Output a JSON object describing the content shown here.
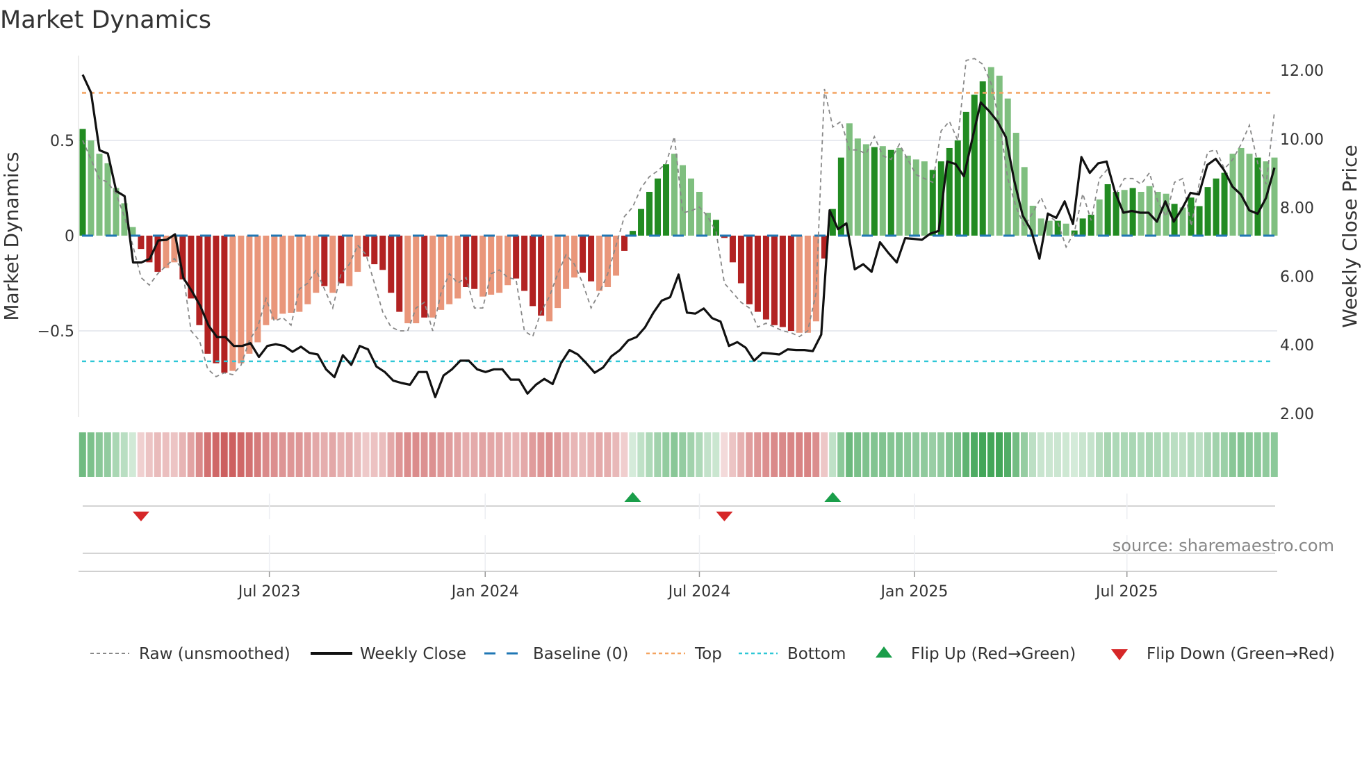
{
  "title": "Market Dynamics",
  "source_note": "source: sharemaestro.com",
  "colors": {
    "pos_strong": "#228B22",
    "pos_weak": "#7fbf7f",
    "neg_strong": "#b22222",
    "neg_weak": "#e9967a",
    "close": "#111111",
    "raw": "#888888",
    "baseline": "#1f77b4",
    "top": "#f4a460",
    "bottom": "#2ec7d6",
    "flip_up": "#1a9e4a",
    "flip_down": "#d62728"
  },
  "chart_data": {
    "type": "bar+line",
    "title": "Market Dynamics",
    "ylabel": "Market Dynamics",
    "y2label": "Weekly Close Price",
    "ylim": [
      -0.98,
      0.87
    ],
    "y2lim": [
      2.0,
      12.0
    ],
    "yticks": [
      {
        "value": 0.5,
        "label": "0.5"
      },
      {
        "value": 0,
        "label": "0"
      },
      {
        "value": -0.5,
        "label": "−0.5"
      }
    ],
    "y2ticks": [
      {
        "value": 12,
        "label": "12.00"
      },
      {
        "value": 10,
        "label": "10.00"
      },
      {
        "value": 8,
        "label": "8.00"
      },
      {
        "value": 6,
        "label": "6.00"
      },
      {
        "value": 4,
        "label": "4.00"
      },
      {
        "value": 2,
        "label": "2.00"
      }
    ],
    "xticks": [
      {
        "week": 22.4,
        "label": "Jul 2023"
      },
      {
        "week": 48.3,
        "label": "Jan 2024"
      },
      {
        "week": 74.0,
        "label": "Jul 2024"
      },
      {
        "week": 99.8,
        "label": "Jan 2025"
      },
      {
        "week": 125.3,
        "label": "Jul 2025"
      }
    ],
    "top_level": 0.75,
    "bottom_level": -0.66,
    "baseline": 0,
    "dynamics": [
      0.56,
      0.5,
      0.43,
      0.38,
      0.25,
      0.17,
      0.045,
      -0.07,
      -0.14,
      -0.19,
      -0.17,
      -0.14,
      -0.23,
      -0.33,
      -0.47,
      -0.62,
      -0.67,
      -0.72,
      -0.71,
      -0.67,
      -0.62,
      -0.56,
      -0.47,
      -0.44,
      -0.41,
      -0.405,
      -0.4,
      -0.36,
      -0.3,
      -0.265,
      -0.3,
      -0.25,
      -0.265,
      -0.19,
      -0.11,
      -0.15,
      -0.18,
      -0.3,
      -0.4,
      -0.46,
      -0.46,
      -0.43,
      -0.43,
      -0.39,
      -0.36,
      -0.33,
      -0.27,
      -0.28,
      -0.32,
      -0.31,
      -0.3,
      -0.26,
      -0.225,
      -0.29,
      -0.37,
      -0.42,
      -0.45,
      -0.38,
      -0.28,
      -0.22,
      -0.195,
      -0.24,
      -0.29,
      -0.27,
      -0.21,
      -0.08,
      0.025,
      0.14,
      0.23,
      0.3,
      0.375,
      0.43,
      0.37,
      0.3,
      0.23,
      0.12,
      0.083,
      -0.012,
      -0.14,
      -0.25,
      -0.36,
      -0.4,
      -0.44,
      -0.47,
      -0.48,
      -0.5,
      -0.51,
      -0.51,
      -0.45,
      -0.12,
      0.14,
      0.41,
      0.59,
      0.51,
      0.48,
      0.465,
      0.47,
      0.45,
      0.46,
      0.42,
      0.4,
      0.39,
      0.345,
      0.39,
      0.46,
      0.5,
      0.65,
      0.74,
      0.81,
      0.885,
      0.84,
      0.72,
      0.54,
      0.36,
      0.157,
      0.09,
      0.078,
      0.078,
      0.063,
      0.027,
      0.09,
      0.11,
      0.19,
      0.27,
      0.23,
      0.24,
      0.25,
      0.23,
      0.26,
      0.23,
      0.22,
      0.167,
      0.148,
      0.2,
      0.155,
      0.255,
      0.3,
      0.33,
      0.43,
      0.46,
      0.43,
      0.41,
      0.39,
      0.41
    ],
    "strength": "DLLLLLLDDDLLDDDDDDLLLLLLLLLLLDLDLLDDDDDLLDLLLLDDLLLLDDDDLLLLDDLLLDDDDDDLLLLLDDDDDDDDDDLLLDDDLLLDLDLLLLDDDDDDDLLLLLLLLDLDDDLDDLDLLLLDLDDDDDLLLD",
    "raw": [
      0.5,
      0.4,
      0.3,
      0.28,
      0.22,
      0.1,
      -0.05,
      -0.22,
      -0.26,
      -0.2,
      -0.16,
      -0.12,
      -0.18,
      -0.5,
      -0.55,
      -0.7,
      -0.74,
      -0.72,
      -0.73,
      -0.68,
      -0.55,
      -0.48,
      -0.33,
      -0.45,
      -0.43,
      -0.47,
      -0.28,
      -0.25,
      -0.18,
      -0.28,
      -0.38,
      -0.2,
      -0.15,
      -0.05,
      -0.1,
      -0.25,
      -0.4,
      -0.48,
      -0.5,
      -0.5,
      -0.38,
      -0.35,
      -0.5,
      -0.3,
      -0.2,
      -0.25,
      -0.22,
      -0.38,
      -0.38,
      -0.2,
      -0.18,
      -0.22,
      -0.23,
      -0.5,
      -0.53,
      -0.4,
      -0.32,
      -0.2,
      -0.1,
      -0.15,
      -0.25,
      -0.38,
      -0.3,
      -0.2,
      -0.05,
      0.1,
      0.15,
      0.25,
      0.31,
      0.34,
      0.38,
      0.52,
      0.12,
      0.13,
      0.15,
      0.1,
      0.02,
      -0.25,
      -0.3,
      -0.35,
      -0.38,
      -0.48,
      -0.46,
      -0.48,
      -0.5,
      -0.51,
      -0.53,
      -0.5,
      -0.3,
      0.77,
      0.57,
      0.6,
      0.45,
      0.45,
      0.43,
      0.52,
      0.42,
      0.4,
      0.48,
      0.4,
      0.32,
      0.3,
      0.28,
      0.55,
      0.6,
      0.5,
      0.92,
      0.93,
      0.9,
      0.8,
      0.6,
      0.3,
      0.15,
      0.05,
      0.12,
      0.2,
      0.1,
      0.07,
      -0.06,
      0.02,
      0.22,
      0.08,
      0.3,
      0.35,
      0.22,
      0.3,
      0.3,
      0.27,
      0.33,
      0.18,
      0.1,
      0.28,
      0.3,
      0.05,
      0.28,
      0.44,
      0.45,
      0.35,
      0.4,
      0.48,
      0.58,
      0.38,
      0.27,
      0.65
    ],
    "weekly_close": [
      11.87,
      11.34,
      9.67,
      9.57,
      8.48,
      8.33,
      6.4,
      6.4,
      6.51,
      7.04,
      7.06,
      7.22,
      5.95,
      5.57,
      5.14,
      4.56,
      4.23,
      4.23,
      3.97,
      3.97,
      4.05,
      3.65,
      3.97,
      4.02,
      3.97,
      3.8,
      3.95,
      3.77,
      3.72,
      3.29,
      3.06,
      3.7,
      3.42,
      3.97,
      3.87,
      3.37,
      3.21,
      2.96,
      2.89,
      2.84,
      3.21,
      3.21,
      2.48,
      3.11,
      3.29,
      3.54,
      3.54,
      3.29,
      3.21,
      3.29,
      3.29,
      2.99,
      2.99,
      2.58,
      2.84,
      3.01,
      2.86,
      3.47,
      3.85,
      3.72,
      3.47,
      3.19,
      3.34,
      3.67,
      3.85,
      4.13,
      4.23,
      4.51,
      4.94,
      5.29,
      5.39,
      6.05,
      4.94,
      4.91,
      5.06,
      4.78,
      4.68,
      3.97,
      4.08,
      3.92,
      3.54,
      3.77,
      3.75,
      3.72,
      3.87,
      3.85,
      3.85,
      3.82,
      4.3,
      7.92,
      7.37,
      7.54,
      6.2,
      6.35,
      6.13,
      6.99,
      6.68,
      6.4,
      7.11,
      7.09,
      7.06,
      7.24,
      7.32,
      9.34,
      9.27,
      8.91,
      10.0,
      11.06,
      10.81,
      10.51,
      10.05,
      8.78,
      7.77,
      7.34,
      6.51,
      7.82,
      7.7,
      8.18,
      7.52,
      9.47,
      9.01,
      9.29,
      9.34,
      8.46,
      7.85,
      7.9,
      7.85,
      7.85,
      7.59,
      8.18,
      7.59,
      7.97,
      8.43,
      8.38,
      9.24,
      9.42,
      9.09,
      8.61,
      8.38,
      7.92,
      7.82,
      8.28,
      9.16
    ],
    "flips": [
      {
        "week": 7,
        "type": "down"
      },
      {
        "week": 66,
        "type": "up"
      },
      {
        "week": 77,
        "type": "down"
      },
      {
        "week": 90,
        "type": "up"
      }
    ],
    "legend": {
      "placement": "bottom",
      "items": [
        {
          "key": "raw",
          "label": "Raw (unsmoothed)"
        },
        {
          "key": "close",
          "label": "Weekly Close"
        },
        {
          "key": "baseline",
          "label": "Baseline (0)"
        },
        {
          "key": "top",
          "label": "Top"
        },
        {
          "key": "bottom",
          "label": "Bottom"
        },
        {
          "key": "flip_up",
          "label": "Flip Up (Red→Green)"
        },
        {
          "key": "flip_down",
          "label": "Flip Down (Green→Red)"
        }
      ]
    }
  }
}
